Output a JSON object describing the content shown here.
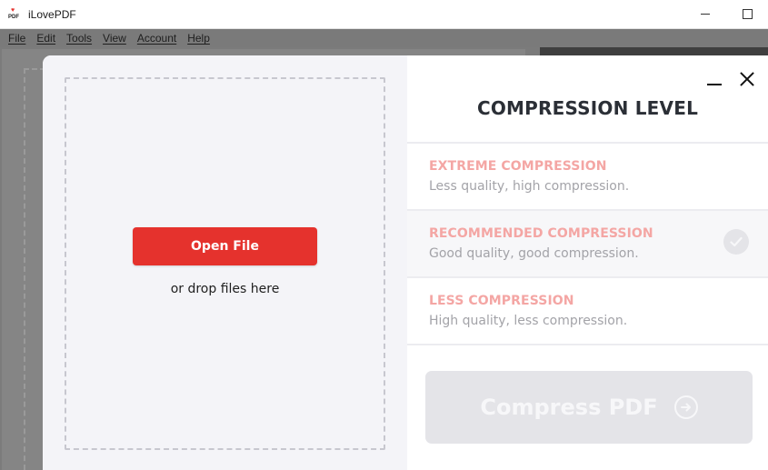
{
  "window": {
    "title": "iLovePDF",
    "logo_text": "PDF"
  },
  "menu": {
    "items": [
      "File",
      "Edit",
      "Tools",
      "View",
      "Account",
      "Help"
    ]
  },
  "upload": {
    "open_button": "Open File",
    "drop_text": "or drop files here"
  },
  "compression": {
    "title": "COMPRESSION LEVEL",
    "options": [
      {
        "title": "EXTREME COMPRESSION",
        "description": "Less quality, high compression.",
        "selected": false
      },
      {
        "title": "RECOMMENDED COMPRESSION",
        "description": "Good quality, good compression.",
        "selected": true
      },
      {
        "title": "LESS COMPRESSION",
        "description": "High quality, less compression.",
        "selected": false
      }
    ],
    "action_button": "Compress PDF"
  },
  "colors": {
    "brand_red": "#e5322d",
    "option_title": "#f4a6a4",
    "disabled_button": "#e4e4e8"
  }
}
